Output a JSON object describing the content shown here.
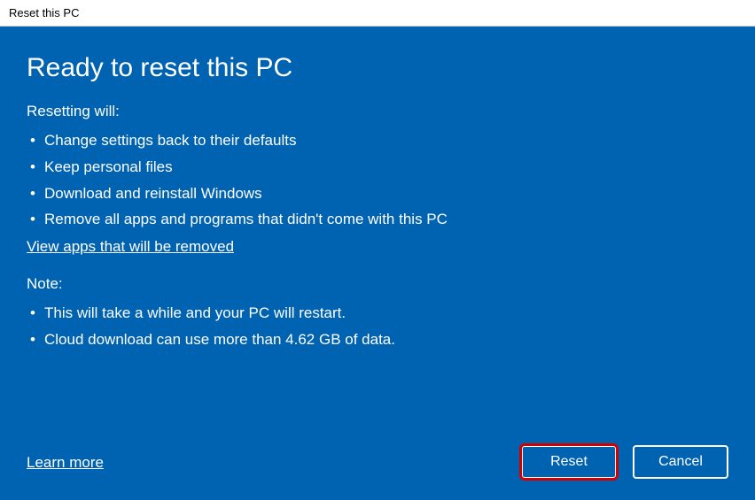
{
  "window": {
    "title": "Reset this PC"
  },
  "main": {
    "heading": "Ready to reset this PC",
    "resetting_label": "Resetting will:",
    "reset_items": [
      "Change settings back to their defaults",
      "Keep personal files",
      "Download and reinstall Windows",
      "Remove all apps and programs that didn't come with this PC"
    ],
    "view_apps_link": "View apps that will be removed",
    "note_label": "Note:",
    "note_items": [
      "This will take a while and your PC will restart.",
      "Cloud download can use more than 4.62 GB of data."
    ]
  },
  "footer": {
    "learn_more": "Learn more",
    "reset_button": "Reset",
    "cancel_button": "Cancel"
  },
  "colors": {
    "accent": "#0063b1",
    "highlight_border": "#d40000"
  }
}
